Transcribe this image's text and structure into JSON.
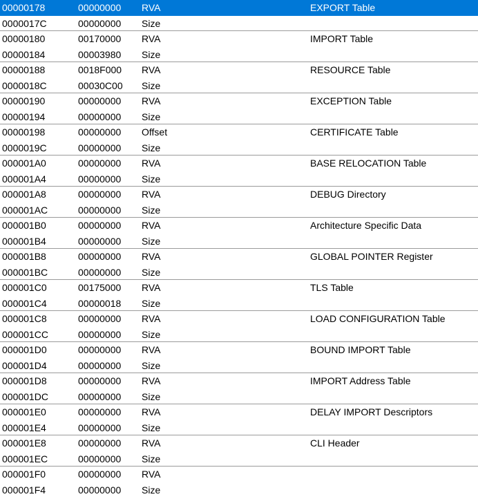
{
  "colors": {
    "selection_background": "#0078d7",
    "selection_text": "#ffffff",
    "row_divider": "#9a9a9a"
  },
  "table": {
    "selected_index": 0,
    "rows": [
      {
        "offset": "00000178",
        "data": "00000000",
        "description": "RVA",
        "value": "EXPORT Table"
      },
      {
        "offset": "0000017C",
        "data": "00000000",
        "description": "Size",
        "value": ""
      },
      {
        "offset": "00000180",
        "data": "00170000",
        "description": "RVA",
        "value": "IMPORT Table"
      },
      {
        "offset": "00000184",
        "data": "00003980",
        "description": "Size",
        "value": ""
      },
      {
        "offset": "00000188",
        "data": "0018F000",
        "description": "RVA",
        "value": "RESOURCE Table"
      },
      {
        "offset": "0000018C",
        "data": "00030C00",
        "description": "Size",
        "value": ""
      },
      {
        "offset": "00000190",
        "data": "00000000",
        "description": "RVA",
        "value": "EXCEPTION Table"
      },
      {
        "offset": "00000194",
        "data": "00000000",
        "description": "Size",
        "value": ""
      },
      {
        "offset": "00000198",
        "data": "00000000",
        "description": "Offset",
        "value": "CERTIFICATE Table"
      },
      {
        "offset": "0000019C",
        "data": "00000000",
        "description": "Size",
        "value": ""
      },
      {
        "offset": "000001A0",
        "data": "00000000",
        "description": "RVA",
        "value": "BASE RELOCATION Table"
      },
      {
        "offset": "000001A4",
        "data": "00000000",
        "description": "Size",
        "value": ""
      },
      {
        "offset": "000001A8",
        "data": "00000000",
        "description": "RVA",
        "value": "DEBUG Directory"
      },
      {
        "offset": "000001AC",
        "data": "00000000",
        "description": "Size",
        "value": ""
      },
      {
        "offset": "000001B0",
        "data": "00000000",
        "description": "RVA",
        "value": "Architecture Specific Data"
      },
      {
        "offset": "000001B4",
        "data": "00000000",
        "description": "Size",
        "value": ""
      },
      {
        "offset": "000001B8",
        "data": "00000000",
        "description": "RVA",
        "value": "GLOBAL POINTER Register"
      },
      {
        "offset": "000001BC",
        "data": "00000000",
        "description": "Size",
        "value": ""
      },
      {
        "offset": "000001C0",
        "data": "00175000",
        "description": "RVA",
        "value": "TLS Table"
      },
      {
        "offset": "000001C4",
        "data": "00000018",
        "description": "Size",
        "value": ""
      },
      {
        "offset": "000001C8",
        "data": "00000000",
        "description": "RVA",
        "value": "LOAD CONFIGURATION Table"
      },
      {
        "offset": "000001CC",
        "data": "00000000",
        "description": "Size",
        "value": ""
      },
      {
        "offset": "000001D0",
        "data": "00000000",
        "description": "RVA",
        "value": "BOUND IMPORT Table"
      },
      {
        "offset": "000001D4",
        "data": "00000000",
        "description": "Size",
        "value": ""
      },
      {
        "offset": "000001D8",
        "data": "00000000",
        "description": "RVA",
        "value": "IMPORT Address Table"
      },
      {
        "offset": "000001DC",
        "data": "00000000",
        "description": "Size",
        "value": ""
      },
      {
        "offset": "000001E0",
        "data": "00000000",
        "description": "RVA",
        "value": "DELAY IMPORT Descriptors"
      },
      {
        "offset": "000001E4",
        "data": "00000000",
        "description": "Size",
        "value": ""
      },
      {
        "offset": "000001E8",
        "data": "00000000",
        "description": "RVA",
        "value": "CLI Header"
      },
      {
        "offset": "000001EC",
        "data": "00000000",
        "description": "Size",
        "value": ""
      },
      {
        "offset": "000001F0",
        "data": "00000000",
        "description": "RVA",
        "value": ""
      },
      {
        "offset": "000001F4",
        "data": "00000000",
        "description": "Size",
        "value": ""
      }
    ]
  }
}
